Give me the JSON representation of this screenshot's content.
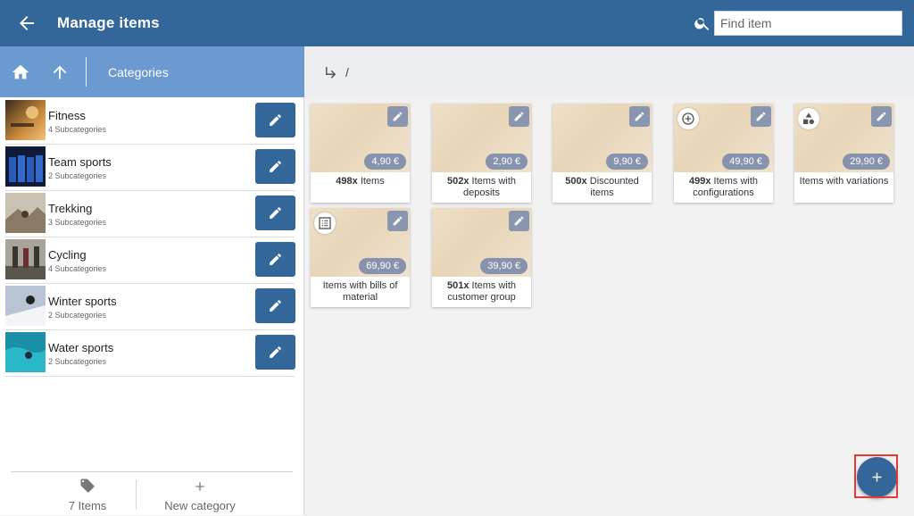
{
  "header": {
    "title": "Manage items",
    "search_placeholder": "Find item"
  },
  "left_header": {
    "title": "Categories"
  },
  "categories": [
    {
      "name": "Fitness",
      "sub": "4 Subcategories"
    },
    {
      "name": "Team sports",
      "sub": "2 Subcategories"
    },
    {
      "name": "Trekking",
      "sub": "3 Subcategories"
    },
    {
      "name": "Cycling",
      "sub": "4 Subcategories"
    },
    {
      "name": "Winter sports",
      "sub": "2 Subcategories"
    },
    {
      "name": "Water sports",
      "sub": "2 Subcategories"
    }
  ],
  "footer": {
    "items_label": "7 Items",
    "new_category_label": "New category"
  },
  "breadcrumb": {
    "root": "/"
  },
  "tiles": [
    {
      "price": "4,90 €",
      "count": "498x",
      "label": "Items",
      "badge": ""
    },
    {
      "price": "2,90 €",
      "count": "502x",
      "label": "Items with deposits",
      "badge": ""
    },
    {
      "price": "9,90 €",
      "count": "500x",
      "label": "Discounted items",
      "badge": ""
    },
    {
      "price": "49,90 €",
      "count": "499x",
      "label": "Items with configurations",
      "badge": "plus-circle-icon"
    },
    {
      "price": "29,90 €",
      "count": "",
      "label": "Items with variations",
      "badge": "shapes-icon"
    },
    {
      "price": "69,90 €",
      "count": "",
      "label": "Items with bills of material",
      "badge": "list-icon"
    },
    {
      "price": "39,90 €",
      "count": "501x",
      "label": "Items with customer group",
      "badge": ""
    }
  ],
  "colors": {
    "primary": "#336699",
    "left_header": "#6a9ad0",
    "price_badge": "#8793ac",
    "highlight": "#e53935"
  }
}
